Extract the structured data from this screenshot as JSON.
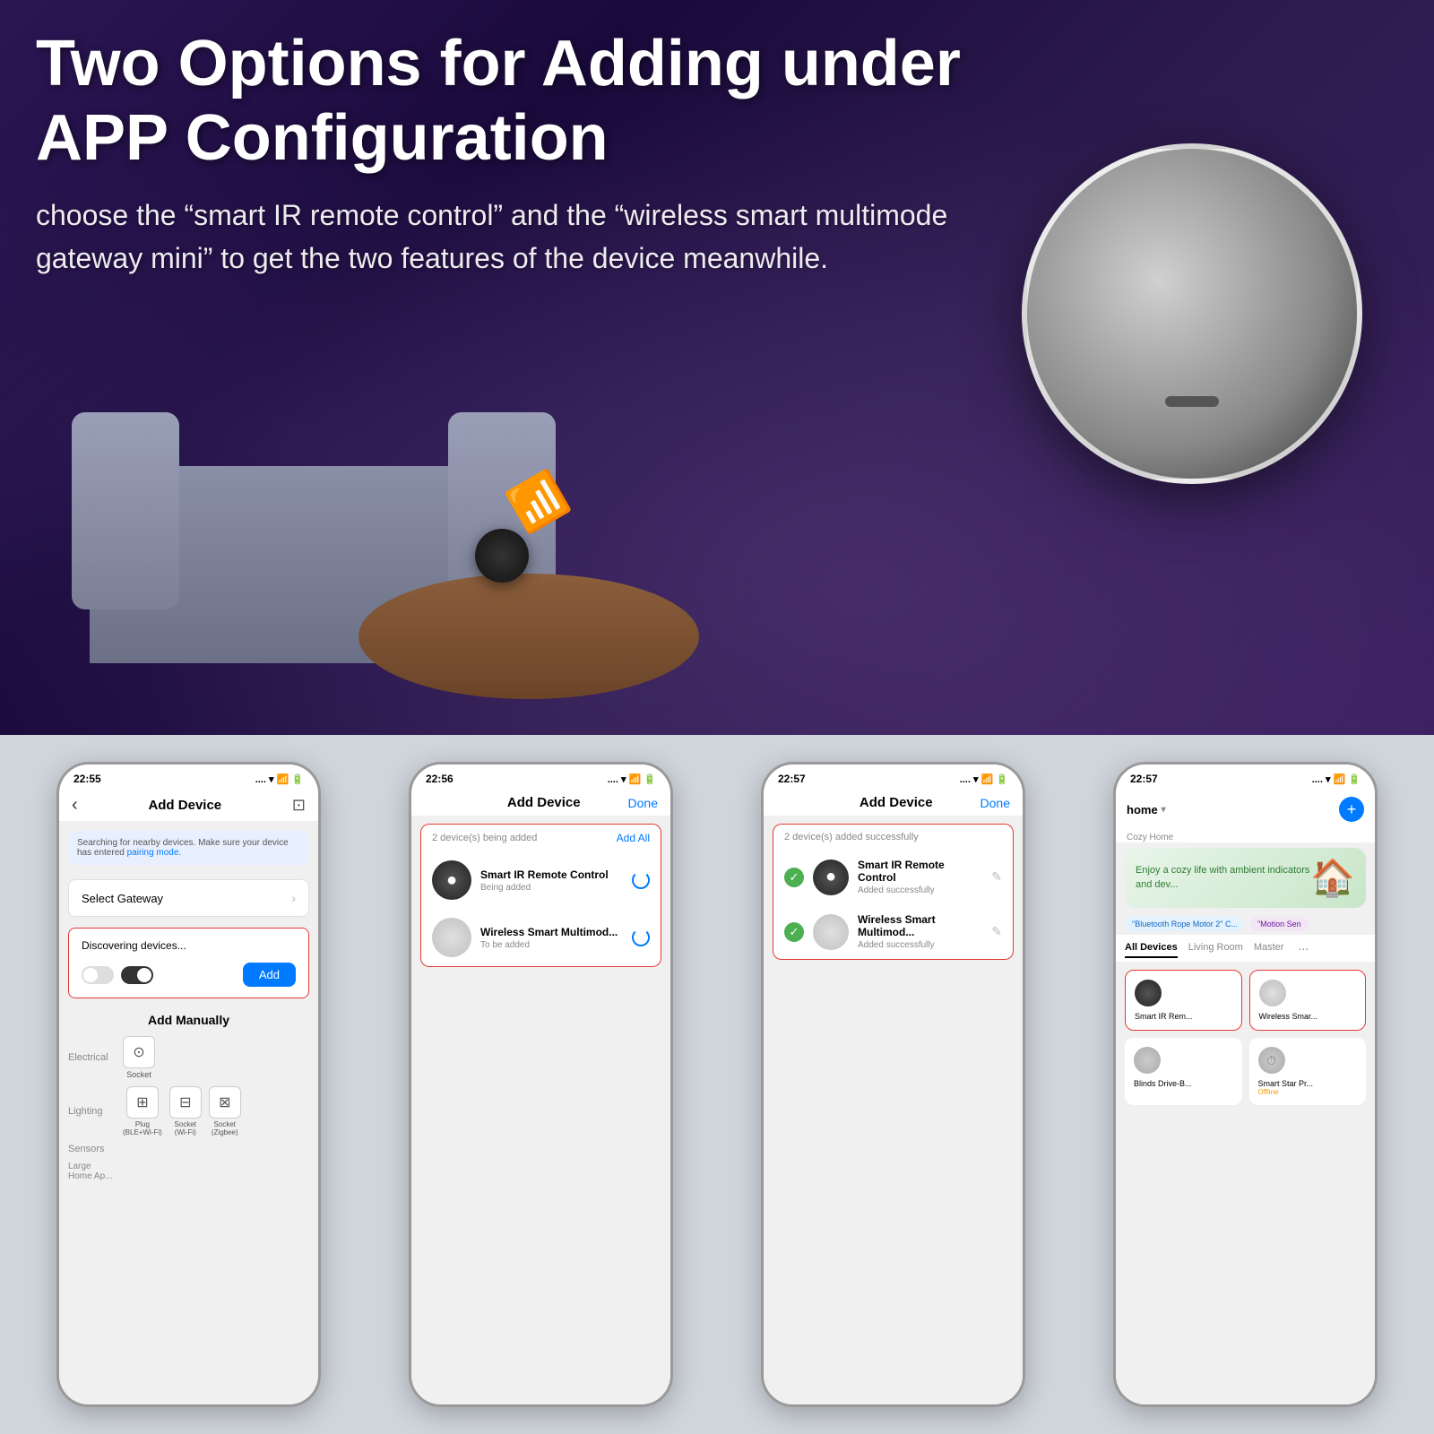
{
  "hero": {
    "title": "Two Options for Adding under APP Configuration",
    "subtitle": "choose the “smart IR remote control” and the “wireless smart multimode gateway mini” to get the two features of the device meanwhile."
  },
  "screens": [
    {
      "id": "screen1",
      "time": "22:55",
      "header_title": "Add Device",
      "search_text": "Searching for nearby devices. Make sure your device has entered ",
      "pairing_mode_link": "pairing mode.",
      "gateway_label": "Select Gateway",
      "discovering_title": "Discovering devices...",
      "add_btn_label": "Add",
      "add_manually_title": "Add Manually",
      "categories": [
        {
          "label": "Electrical",
          "items": [
            "Socket"
          ]
        },
        {
          "label": "Lighting",
          "items": [
            "Plug\n(BLE+Wi-Fi)",
            "Socket\n(Wi-Fi)",
            "Socket\n(Zigbee)"
          ]
        },
        {
          "label": "Sensors",
          "items": []
        },
        {
          "label": "Large\nHome Ap...",
          "items": []
        }
      ]
    },
    {
      "id": "screen2",
      "time": "22:56",
      "header_title": "Add Device",
      "done_label": "Done",
      "being_added_count": "2 device(s) being added",
      "add_all_label": "Add All",
      "devices": [
        {
          "name": "Smart IR Remote Control",
          "status": "Being added",
          "type": "dark"
        },
        {
          "name": "Wireless Smart Multimod...",
          "status": "To be added",
          "type": "light"
        }
      ]
    },
    {
      "id": "screen3",
      "time": "22:57",
      "header_title": "Add Device",
      "done_label": "Done",
      "added_count": "2 device(s) added successfully",
      "devices": [
        {
          "name": "Smart IR Remote Control",
          "status": "Added successfully",
          "type": "dark"
        },
        {
          "name": "Wireless Smart Multimod...",
          "status": "Added successfully",
          "type": "light"
        }
      ]
    },
    {
      "id": "screen4",
      "time": "22:57",
      "home_label": "home",
      "cozy_home": "Cozy Home",
      "banner_text": "Enjoy a cozy life\nwith ambient\nindicators and dev...",
      "tags": [
        "\"Bluetooth Rope Motor 2\" C...",
        "\"Motion Sen"
      ],
      "tabs": [
        "All Devices",
        "Living Room",
        "Master",
        "..."
      ],
      "devices": [
        {
          "name": "Smart IR Rem...",
          "type": "dark",
          "offline": false
        },
        {
          "name": "Wireless Smar...",
          "type": "light",
          "offline": false
        },
        {
          "name": "Blinds Drive-B...",
          "type": "gray",
          "offline": false
        },
        {
          "name": "Smart Star Pr...",
          "type": "clock",
          "offline": true,
          "offline_label": "Offline"
        }
      ]
    }
  ]
}
